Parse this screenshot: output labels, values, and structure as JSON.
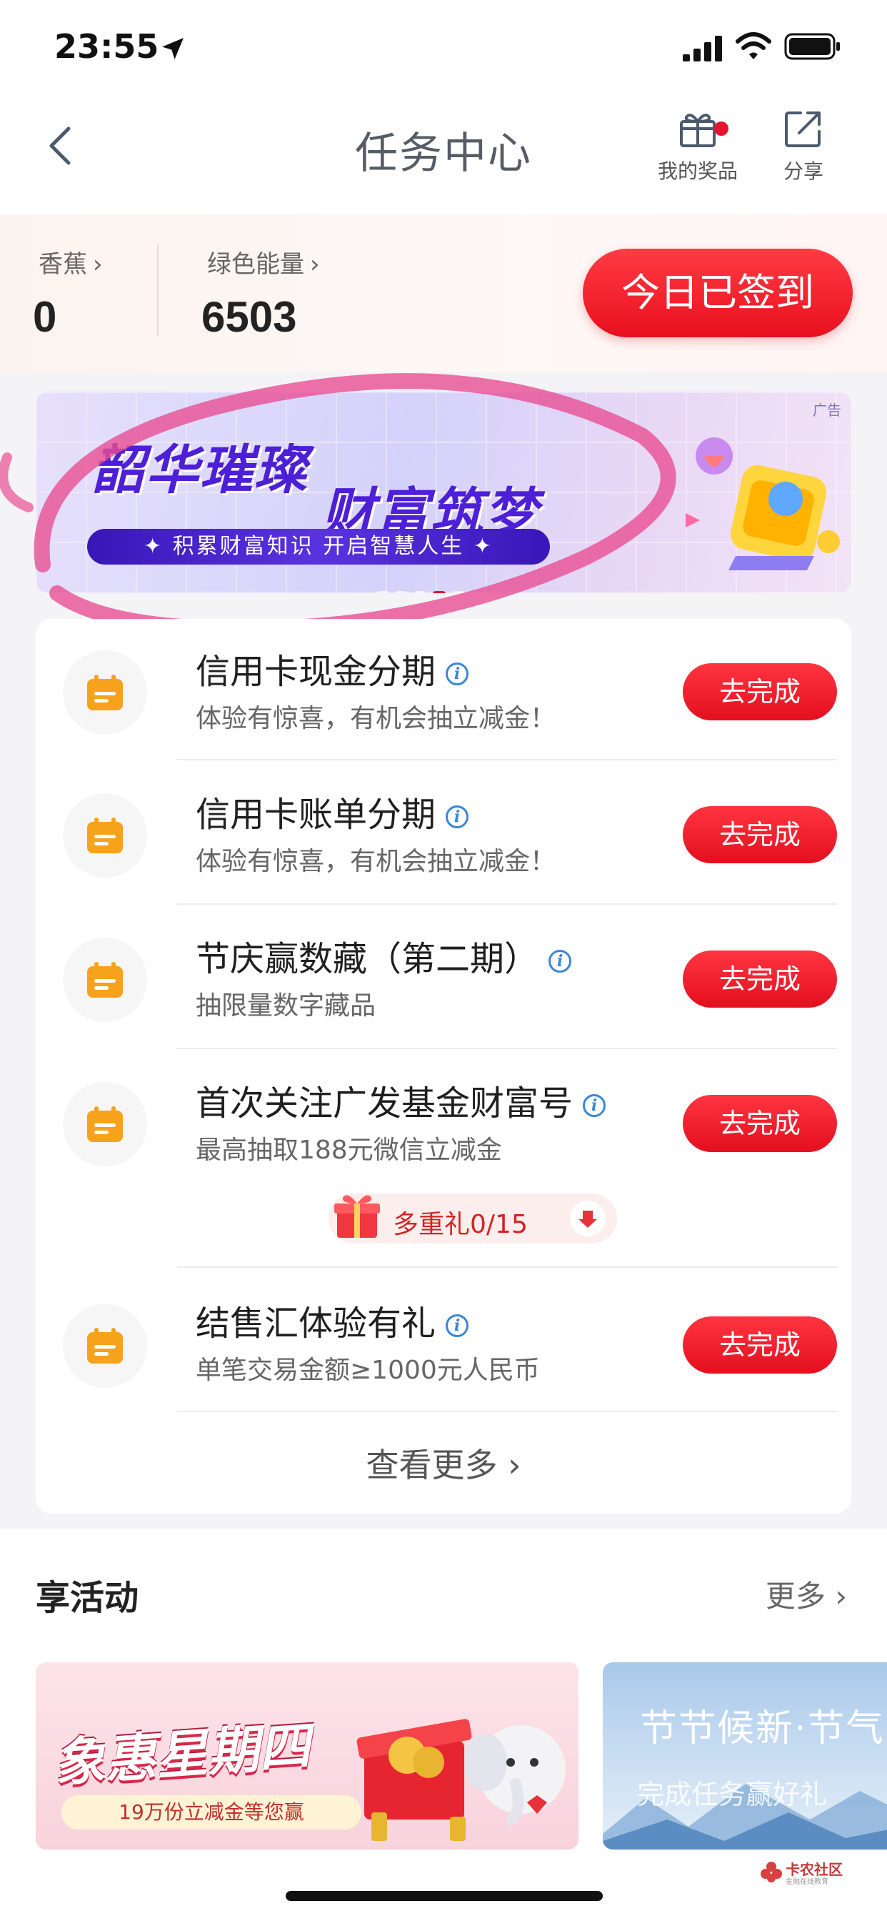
{
  "status_bar": {
    "time": "23:55"
  },
  "nav": {
    "title": "任务中心",
    "prizes_label": "我的奖品",
    "share_label": "分享"
  },
  "points": {
    "banana_label": "香蕉",
    "banana_value": "0",
    "energy_label": "绿色能量",
    "energy_value": "6503",
    "signed_button": "今日已签到"
  },
  "banner": {
    "ad_tag": "广告",
    "title_line1": "韶华璀璨",
    "title_line2": "财富筑梦",
    "ribbon": "积累财富知识  开启智慧人生",
    "dots_count": 5,
    "active_dot": 4
  },
  "tasks": [
    {
      "title": "信用卡现金分期",
      "subtitle": "体验有惊喜，有机会抽立减金！",
      "button": "去完成"
    },
    {
      "title": "信用卡账单分期",
      "subtitle": "体验有惊喜，有机会抽立减金！",
      "button": "去完成"
    },
    {
      "title": "节庆赢数藏（第二期）",
      "subtitle": "抽限量数字藏品",
      "button": "去完成"
    },
    {
      "title": "首次关注广发基金财富号",
      "subtitle": "最高抽取188元微信立减金",
      "button": "去完成",
      "gift": "多重礼0/15"
    },
    {
      "title": "结售汇体验有礼",
      "subtitle": "单笔交易金额≥1000元人民币",
      "button": "去完成"
    }
  ],
  "more_link": "查看更多",
  "activities": {
    "title": "享活动",
    "more": "更多",
    "card1_title": "象惠星期四",
    "card1_ribbon": "19万份立减金等您赢",
    "card2_title": "节节候新·节气",
    "card2_sub": "完成任务赢好礼"
  },
  "watermark": {
    "name": "卡农社区",
    "sub": "金融在线教育"
  },
  "colors": {
    "accent_red": "#e8101e",
    "info_blue": "#3a86d8",
    "icon_orange": "#f7a21b",
    "banner_purple": "#4d1fd6"
  }
}
